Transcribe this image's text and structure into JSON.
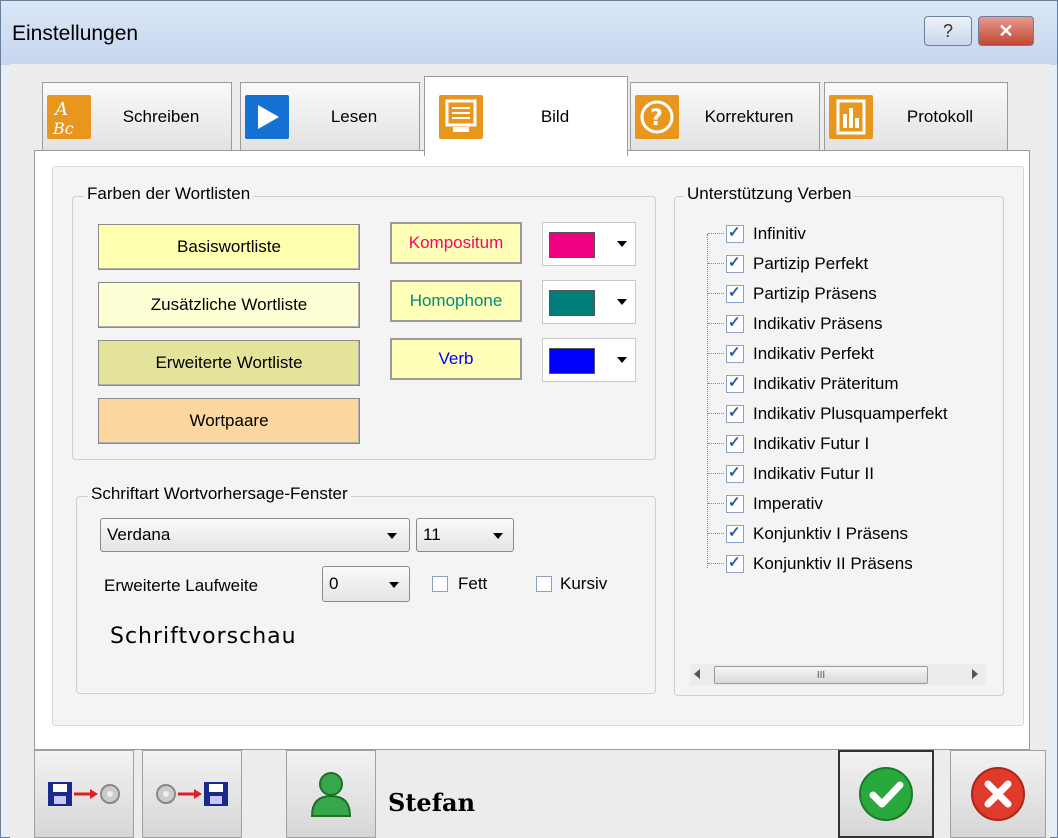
{
  "window": {
    "title": "Einstellungen",
    "help_glyph": "?",
    "close_glyph": "✕"
  },
  "tabs": [
    {
      "label": "Schreiben",
      "icon": "abc-icon",
      "icon_text": "A Bc",
      "active": false
    },
    {
      "label": "Lesen",
      "icon": "play-icon",
      "active": false
    },
    {
      "label": "Bild",
      "icon": "monitor-icon",
      "active": true
    },
    {
      "label": "Korrekturen",
      "icon": "question-icon",
      "icon_text": "?",
      "active": false
    },
    {
      "label": "Protokoll",
      "icon": "report-chart-icon",
      "active": false
    }
  ],
  "wordlist_colors": {
    "legend": "Farben der Wortlisten",
    "buttons": {
      "basis": "Basiswortliste",
      "zusaetzlich": "Zusätzliche Wortliste",
      "erweitert": "Erweiterte Wortliste",
      "wortpaare": "Wortpaare"
    },
    "button_colors": {
      "basis": "#ffffb0",
      "zusaetzlich": "#ffffd6",
      "erweitert": "#e3e39a",
      "wortpaare": "#fcd8a0"
    },
    "samples": [
      {
        "label": "Kompositum",
        "text_color": "#ff0066",
        "swatch": "#f00080"
      },
      {
        "label": "Homophone",
        "text_color": "#008a80",
        "swatch": "#007f7a"
      },
      {
        "label": "Verb",
        "text_color": "#0000ff",
        "swatch": "#0000ff"
      }
    ]
  },
  "font_settings": {
    "legend": "Schriftart Wortvorhersage-Fenster",
    "font_value": "Verdana",
    "size_value": "11",
    "spacing_label": "Erweiterte Laufweite",
    "spacing_value": "0",
    "bold_label": "Fett",
    "italic_label": "Kursiv",
    "bold_checked": false,
    "italic_checked": false,
    "preview": "Schriftvorschau"
  },
  "verbs": {
    "legend": "Unterstützung Verben",
    "items": [
      "Infinitiv",
      "Partizip Perfekt",
      "Partizip Präsens",
      "Indikativ Präsens",
      "Indikativ Perfekt",
      "Indikativ Präteritum",
      "Indikativ Plusquamperfekt",
      "Indikativ Futur I",
      "Indikativ Futur II",
      "Imperativ",
      "Konjunktiv I Präsens",
      "Konjunktiv II Präsens"
    ],
    "scroll_glyph": "III"
  },
  "bottom": {
    "user_name": "Stefan",
    "colors": {
      "ok": "#29a83b",
      "cancel": "#e03a2a",
      "user": "#37a84a"
    }
  }
}
